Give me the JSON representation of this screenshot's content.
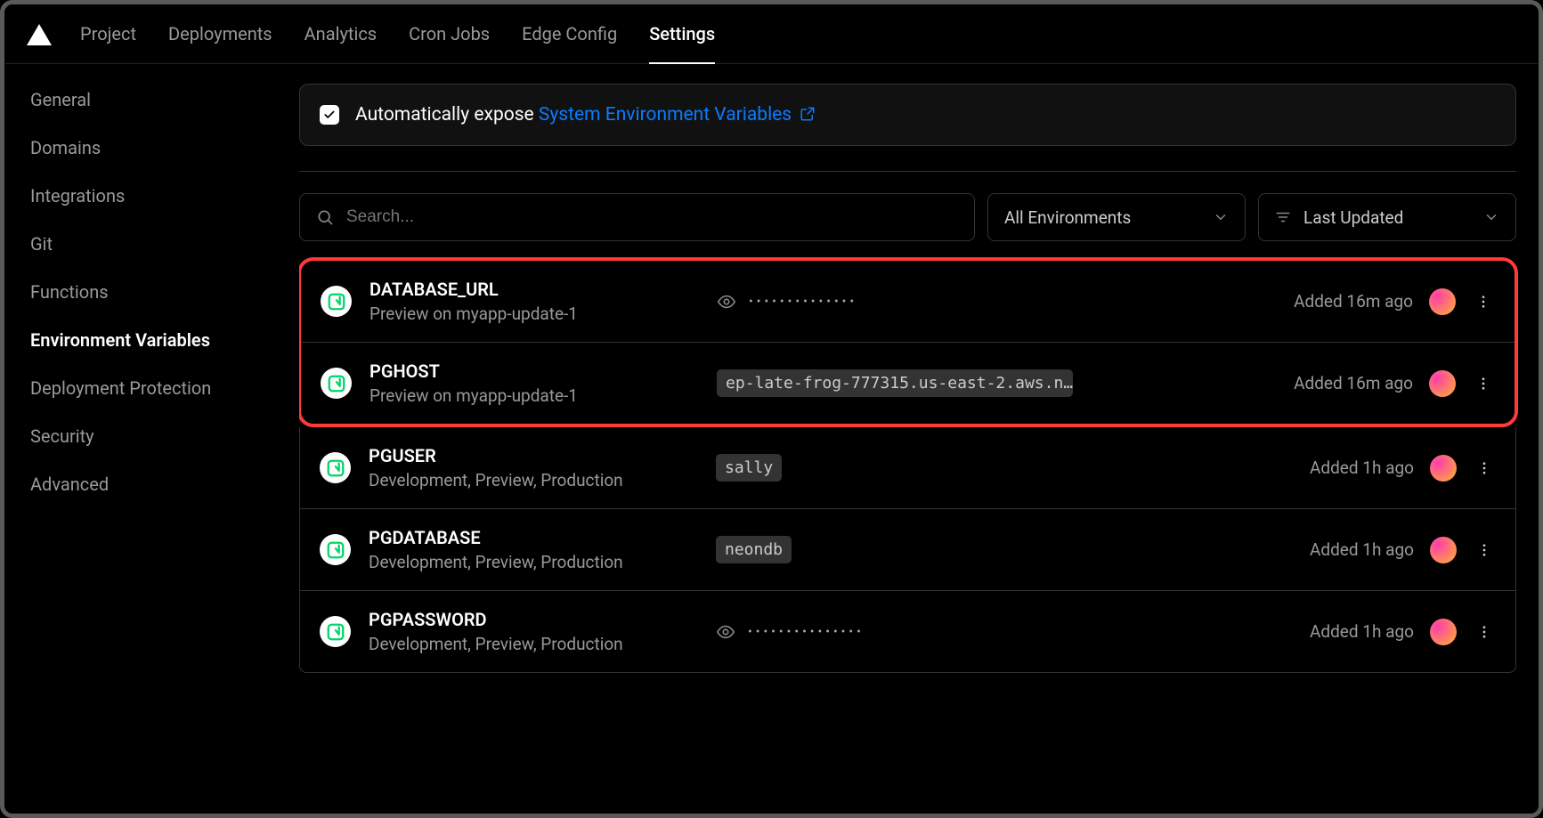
{
  "nav": {
    "items": [
      "Project",
      "Deployments",
      "Analytics",
      "Cron Jobs",
      "Edge Config",
      "Settings"
    ],
    "activeIndex": 5
  },
  "sidebar": {
    "items": [
      "General",
      "Domains",
      "Integrations",
      "Git",
      "Functions",
      "Environment Variables",
      "Deployment Protection",
      "Security",
      "Advanced"
    ],
    "activeIndex": 5
  },
  "banner": {
    "text_before": "Automatically expose ",
    "link_text": "System Environment Variables",
    "checked": true
  },
  "controls": {
    "search_placeholder": "Search...",
    "env_filter": "All Environments",
    "sort": "Last Updated"
  },
  "vars": [
    {
      "name": "DATABASE_URL",
      "scope": "Preview on myapp-update-1",
      "masked": true,
      "value": "••••••••••••••",
      "added": "Added 16m ago",
      "highlighted": true
    },
    {
      "name": "PGHOST",
      "scope": "Preview on myapp-update-1",
      "masked": false,
      "value": "ep-late-frog-777315.us-east-2.aws.n…",
      "added": "Added 16m ago",
      "highlighted": true
    },
    {
      "name": "PGUSER",
      "scope": "Development, Preview, Production",
      "masked": false,
      "value": "sally",
      "added": "Added 1h ago",
      "highlighted": false
    },
    {
      "name": "PGDATABASE",
      "scope": "Development, Preview, Production",
      "masked": false,
      "value": "neondb",
      "added": "Added 1h ago",
      "highlighted": false
    },
    {
      "name": "PGPASSWORD",
      "scope": "Development, Preview, Production",
      "masked": true,
      "value": "•••••••••••••••",
      "added": "Added 1h ago",
      "highlighted": false
    }
  ]
}
